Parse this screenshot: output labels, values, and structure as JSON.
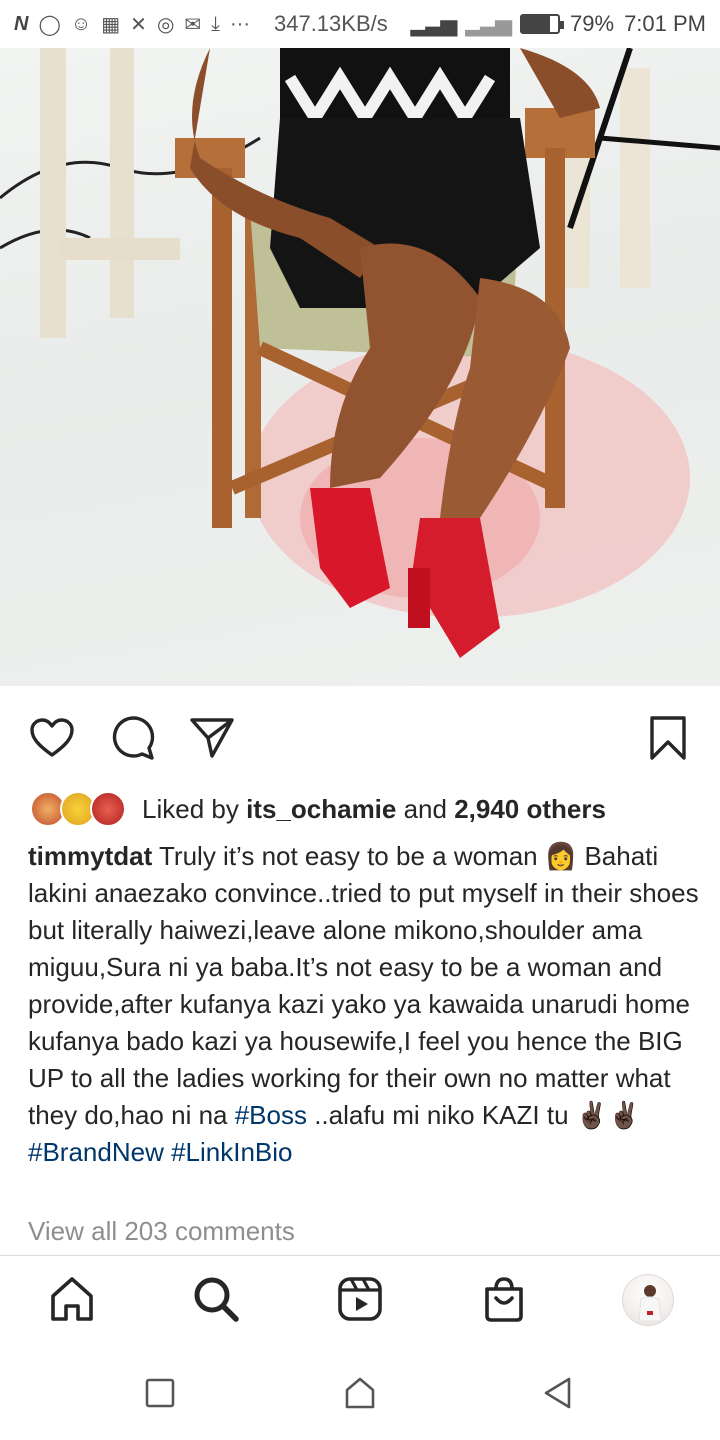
{
  "status_bar": {
    "icons": [
      "N",
      "whatsapp-icon",
      "messenger-icon",
      "image-icon",
      "x-icon",
      "instagram-icon",
      "mail-icon",
      "download-icon",
      "···"
    ],
    "speed": "347.13KB/s",
    "battery": "79%",
    "battery_level": 0.79,
    "time": "7:01 PM"
  },
  "post": {
    "liked_by_prefix": "Liked by ",
    "liked_by_user": "its_ochamie",
    "liked_by_and": " and ",
    "liked_by_count": "2,940 others",
    "username": "timmytdat",
    "caption_part1": " Truly it’s not easy to be a woman 👩 Bahati lakini anaezako convince..tried to put myself in their shoes but literally haiwezi,leave alone mikono,shoulder ama miguu,Sura ni ya baba.It’s not easy to be a woman and provide,after kufanya kazi yako ya kawaida unarudi home kufanya bado kazi ya housewife,I feel you hence the BIG UP to all the ladies working for their own no matter what they do,hao ni na ",
    "hashtag_boss": "#Boss",
    "caption_part2": " ..alafu mi niko KAZI tu ✌🏿✌🏿",
    "hashtag_brandnew": "#BrandNew",
    "hashtag_linkinbio": "#LinkInBio",
    "view_all_comments": "View all 203 comments"
  },
  "colors": {
    "text": "#262626",
    "hashtag": "#00376b",
    "muted": "#8e8e8e",
    "divider": "#dbdbdb"
  }
}
